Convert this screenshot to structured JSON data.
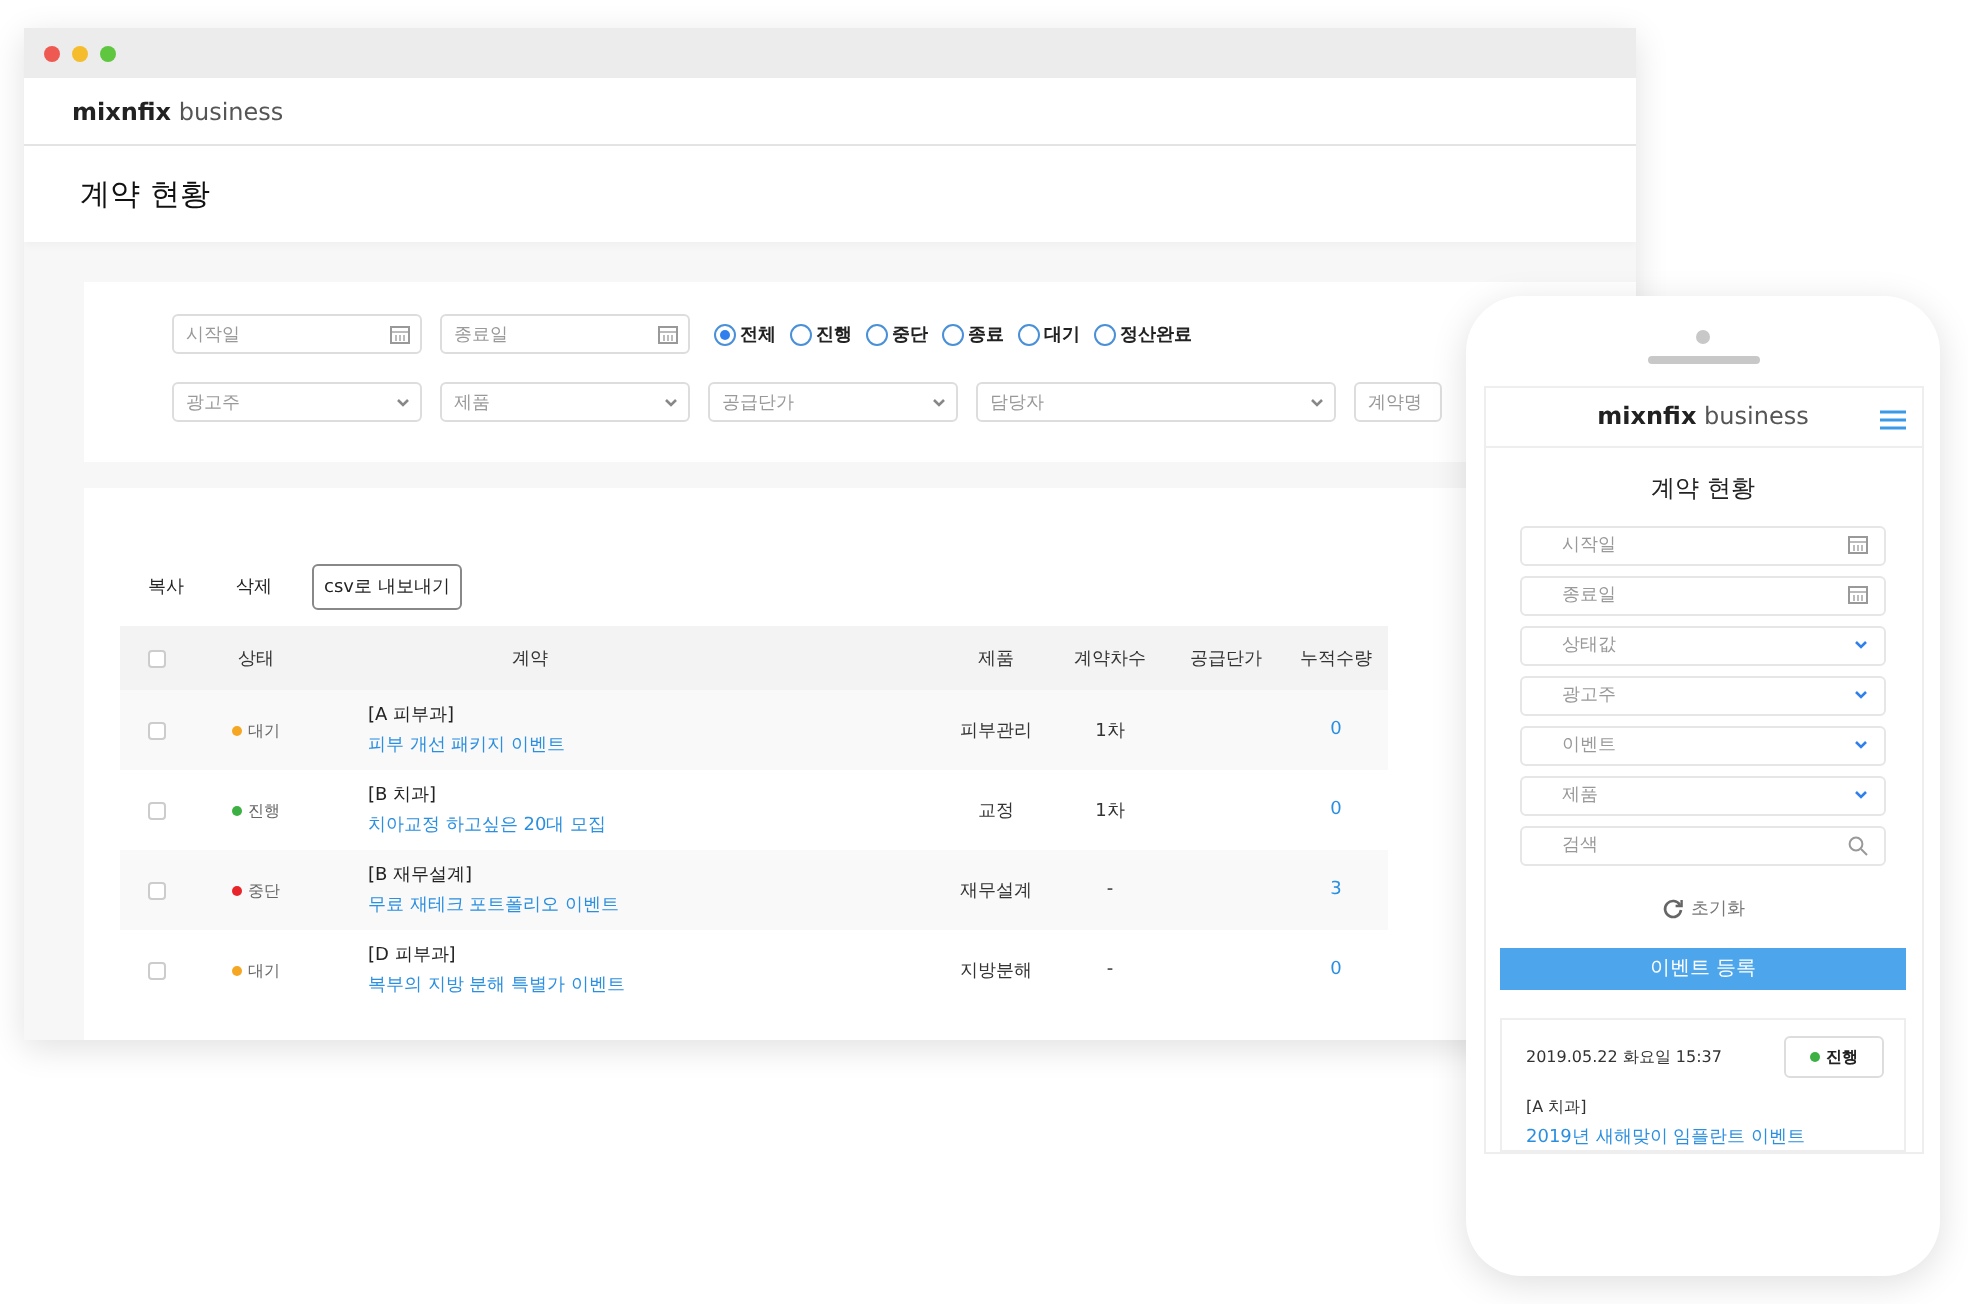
{
  "desktop": {
    "brand": {
      "name": "mixnfix",
      "suffix": "business"
    },
    "page_title": "계약 현황",
    "date_fields": [
      {
        "placeholder": "시작일"
      },
      {
        "placeholder": "종료일"
      }
    ],
    "status_radios": [
      {
        "label": "전체",
        "selected": true
      },
      {
        "label": "진행",
        "selected": false
      },
      {
        "label": "중단",
        "selected": false
      },
      {
        "label": "종료",
        "selected": false
      },
      {
        "label": "대기",
        "selected": false
      },
      {
        "label": "정산완료",
        "selected": false
      }
    ],
    "filters": [
      {
        "placeholder": "광고주",
        "kind": "select"
      },
      {
        "placeholder": "제품",
        "kind": "select"
      },
      {
        "placeholder": "공급단가",
        "kind": "select"
      },
      {
        "placeholder": "담당자",
        "kind": "select",
        "wide": true
      },
      {
        "placeholder": "계약명",
        "kind": "text"
      }
    ],
    "actions": [
      "복사",
      "삭제"
    ],
    "export_button": "csv로 내보내기",
    "table": {
      "select_all_checked": false,
      "columns": [
        "상태",
        "계약",
        "제품",
        "계약차수",
        "공급단가",
        "누적수량"
      ],
      "rows": [
        {
          "checked": false,
          "status": "대기",
          "color": "#f5a623",
          "group": "[A 피부과]",
          "title": "피부 개선 패키지 이벤트",
          "product": "피부관리",
          "round": "1차",
          "count": "0"
        },
        {
          "checked": false,
          "status": "진행",
          "color": "#3cb043",
          "group": "[B 치과]",
          "title": "치아교정 하고싶은 20대 모집",
          "product": "교정",
          "round": "1차",
          "count": "0"
        },
        {
          "checked": false,
          "status": "중단",
          "color": "#e8252a",
          "group": "[B 재무설계]",
          "title": "무료 재테크 포트폴리오 이벤트",
          "product": "재무설계",
          "round": "-",
          "count": "3"
        },
        {
          "checked": false,
          "status": "대기",
          "color": "#f5a623",
          "group": "[D 피부과]",
          "title": "복부의 지방 분해 특별가 이벤트",
          "product": "지방분해",
          "round": "-",
          "count": "0"
        }
      ]
    }
  },
  "mobile": {
    "brand": {
      "name": "mixnfix",
      "suffix": "business"
    },
    "page_title": "계약 현황",
    "fields": [
      {
        "placeholder": "시작일",
        "kind": "date"
      },
      {
        "placeholder": "종료일",
        "kind": "date"
      },
      {
        "placeholder": "상태값",
        "kind": "select"
      },
      {
        "placeholder": "광고주",
        "kind": "select"
      },
      {
        "placeholder": "이벤트",
        "kind": "select"
      },
      {
        "placeholder": "제품",
        "kind": "select"
      },
      {
        "placeholder": "검색",
        "kind": "search"
      }
    ],
    "reset_label": "초기화",
    "register_button": "이벤트 등록",
    "card": {
      "date": "2019.05.22 화요일 15:37",
      "status": "진행",
      "color": "#3cb043",
      "group": "[A 치과]",
      "title": "2019년 새해맞이 임플란트 이벤트"
    }
  }
}
